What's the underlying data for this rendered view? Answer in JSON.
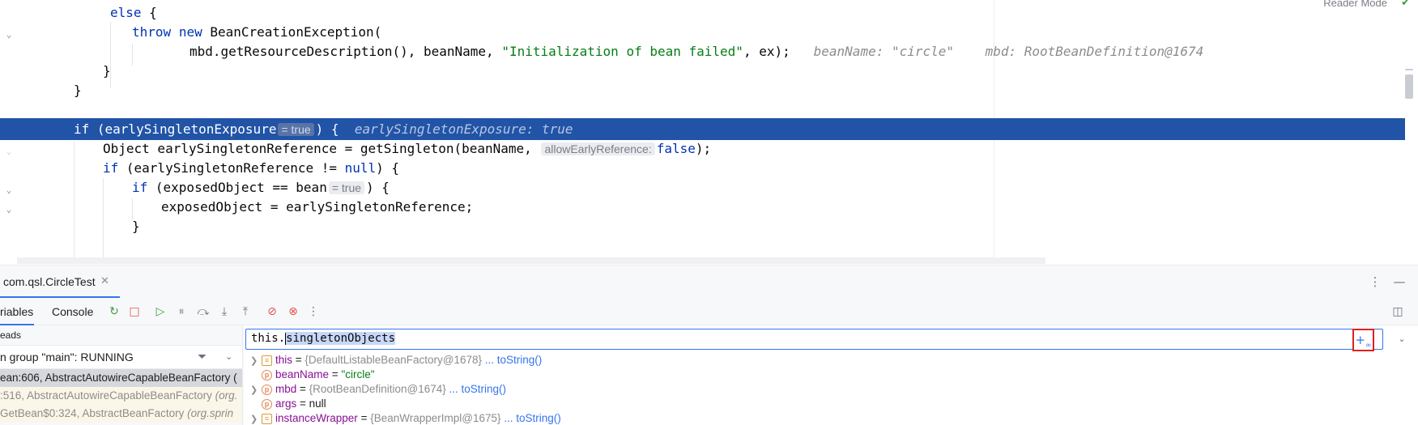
{
  "editor": {
    "reader_mode_label": "Reader Mode",
    "lines": {
      "l1": {
        "else": "else",
        "brace": " {"
      },
      "l2": {
        "throw": "throw",
        "new": "new",
        "rest": " BeanCreationException("
      },
      "l3": {
        "pre": "mbd.getResourceDescription(), beanName, ",
        "str": "\"Initialization of bean failed\"",
        "post": ", ex);",
        "hint": "beanName: \"circle\"    mbd: RootBeanDefinition@1674"
      },
      "l4": {
        "text": "}"
      },
      "l5": {
        "text": "}"
      },
      "l6": {
        "if": "if",
        "pre": " (earlySingletonExposure",
        "badge": "= true",
        "post": ") {",
        "hint": "earlySingletonExposure: true"
      },
      "l7": {
        "pre": "Object earlySingletonReference = getSingleton(beanName, ",
        "param": "allowEarlyReference:",
        "false": "false",
        "post": ");"
      },
      "l8": {
        "if": "if",
        "pre": " (earlySingletonReference != ",
        "null": "null",
        "post": ") {"
      },
      "l9": {
        "if": "if",
        "pre": " (exposedObject == bean",
        "badge": "= true",
        "post": ") {"
      },
      "l10": {
        "text": "exposedObject = earlySingletonReference;"
      },
      "l11": {
        "text": "}"
      }
    }
  },
  "debug": {
    "run_tab_label": "com.qsl.CircleTest",
    "tabs": {
      "variables": "riables",
      "console": "Console"
    },
    "threads_title": "eads",
    "thread_group": "n group \"main\": RUNNING",
    "frames": [
      {
        "main": "ean:606, AbstractAutowireCapableBeanFactory (",
        "pkg": ""
      },
      {
        "main": ":516, AbstractAutowireCapableBeanFactory ",
        "pkg": "(org."
      },
      {
        "main": "GetBean$0:324, AbstractBeanFactory ",
        "pkg": "(org.sprin"
      }
    ],
    "eval": {
      "prefix": "this.",
      "selected": "singletonObjects"
    },
    "variables": [
      {
        "name": "this",
        "value": "{DefaultListableBeanFactory@1678}",
        "link": "... toString()"
      },
      {
        "name": "beanName",
        "value": "\"circle\"",
        "link": ""
      },
      {
        "name": "mbd",
        "value": "{RootBeanDefinition@1674}",
        "link": "... toString()"
      },
      {
        "name": "args",
        "value": "null",
        "link": ""
      },
      {
        "name": "instanceWrapper",
        "value": "{BeanWrapperImpl@1675}",
        "link": "... toString()"
      }
    ]
  }
}
